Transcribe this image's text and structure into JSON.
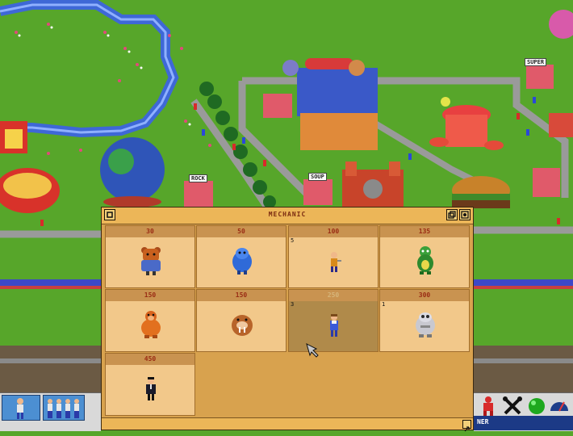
{
  "window": {
    "title": "MECHANIC",
    "items": [
      {
        "price": "30",
        "count": "",
        "sprite": "mechanic-bear-icon",
        "selected": false
      },
      {
        "price": "50",
        "count": "",
        "sprite": "mechanic-blue-blob-icon",
        "selected": false
      },
      {
        "price": "100",
        "count": "5",
        "sprite": "mechanic-small-worker-icon",
        "selected": false
      },
      {
        "price": "135",
        "count": "",
        "sprite": "mechanic-green-lizard-icon",
        "selected": false
      },
      {
        "price": "150",
        "count": "",
        "sprite": "mechanic-orange-gorilla-icon",
        "selected": false
      },
      {
        "price": "150",
        "count": "",
        "sprite": "mechanic-walrus-icon",
        "selected": false
      },
      {
        "price": "250",
        "count": "3",
        "sprite": "mechanic-overalls-worker-icon",
        "selected": true
      },
      {
        "price": "300",
        "count": "1",
        "sprite": "mechanic-grey-robot-icon",
        "selected": false
      },
      {
        "price": "450",
        "count": "",
        "sprite": "mechanic-suit-worker-icon",
        "selected": false
      }
    ],
    "buttons": {
      "minimize": "minimize-icon",
      "restore": "restore-window-icon",
      "help": "help-magnifier-icon",
      "resize": "resize-grip-icon"
    }
  },
  "park": {
    "signs": [
      "SUPER",
      "ROCK",
      "SOUP"
    ]
  },
  "toolbar": {
    "left_tools": [
      "single-visitor-icon",
      "visitor-group-icon"
    ],
    "right_tools": [
      "staff-icon",
      "tools-icon",
      "green-status-icon",
      "speed-gauge-icon"
    ],
    "status_text": "NER"
  },
  "colors": {
    "grass": "#57a62a",
    "window_bg": "#d8a24e",
    "cell_bg": "#f2c88a",
    "price_text": "#9a2c14",
    "toolbar_blue": "#4c8fd2"
  }
}
